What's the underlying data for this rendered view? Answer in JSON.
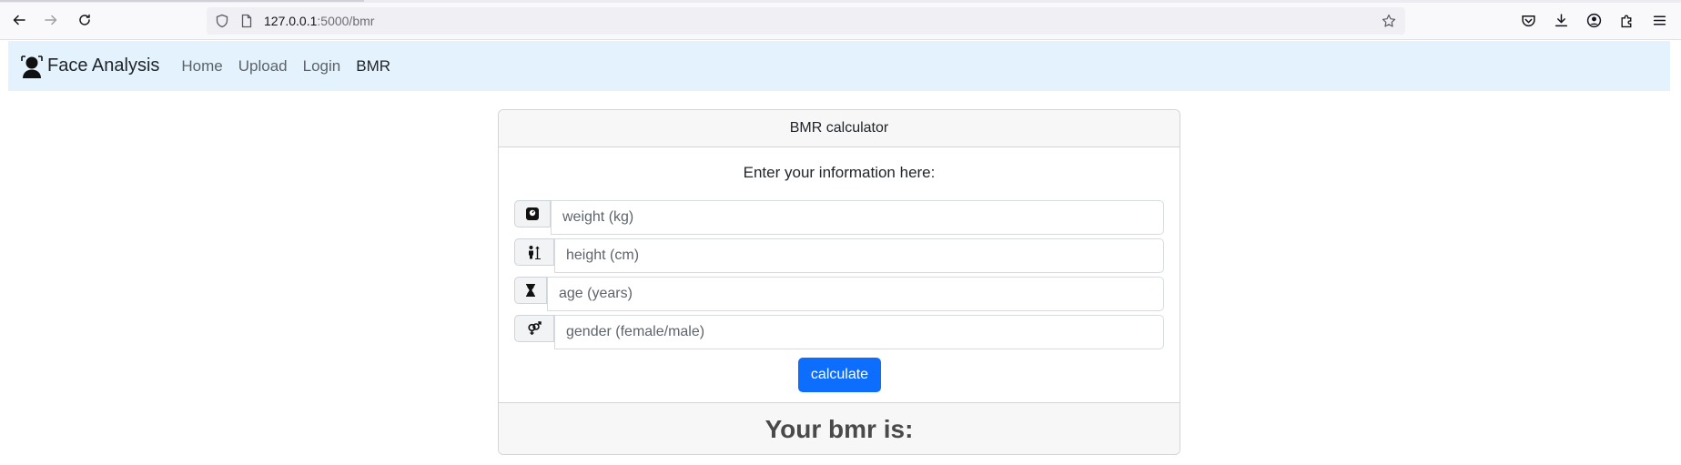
{
  "browser": {
    "url_host": "127.0.0.1",
    "url_path": ":5000/bmr",
    "icons": [
      "back-arrow-icon",
      "forward-arrow-icon",
      "reload-icon",
      "shield-icon",
      "page-icon",
      "bookmark-star-icon",
      "pocket-icon",
      "download-icon",
      "account-icon",
      "extensions-icon",
      "menu-icon"
    ]
  },
  "navbar": {
    "brand": "Face Analysis",
    "brand_icon": "face-person-icon",
    "background": "#e3f2fd",
    "links": [
      "Home",
      "Upload",
      "Login",
      "BMR"
    ],
    "active": "BMR"
  },
  "card": {
    "header": "BMR calculator",
    "intro": "Enter your information here:",
    "fields": [
      {
        "icon": "scale-icon",
        "placeholder": "weight (kg)",
        "value": ""
      },
      {
        "icon": "height-person-icon",
        "placeholder": "height (cm)",
        "value": ""
      },
      {
        "icon": "hourglass-icon",
        "placeholder": "age (years)",
        "value": ""
      },
      {
        "icon": "gender-icon",
        "placeholder": "gender (female/male)",
        "value": ""
      }
    ],
    "button": "calculate",
    "button_color": "#0d6efd",
    "result": "Your bmr is:"
  }
}
